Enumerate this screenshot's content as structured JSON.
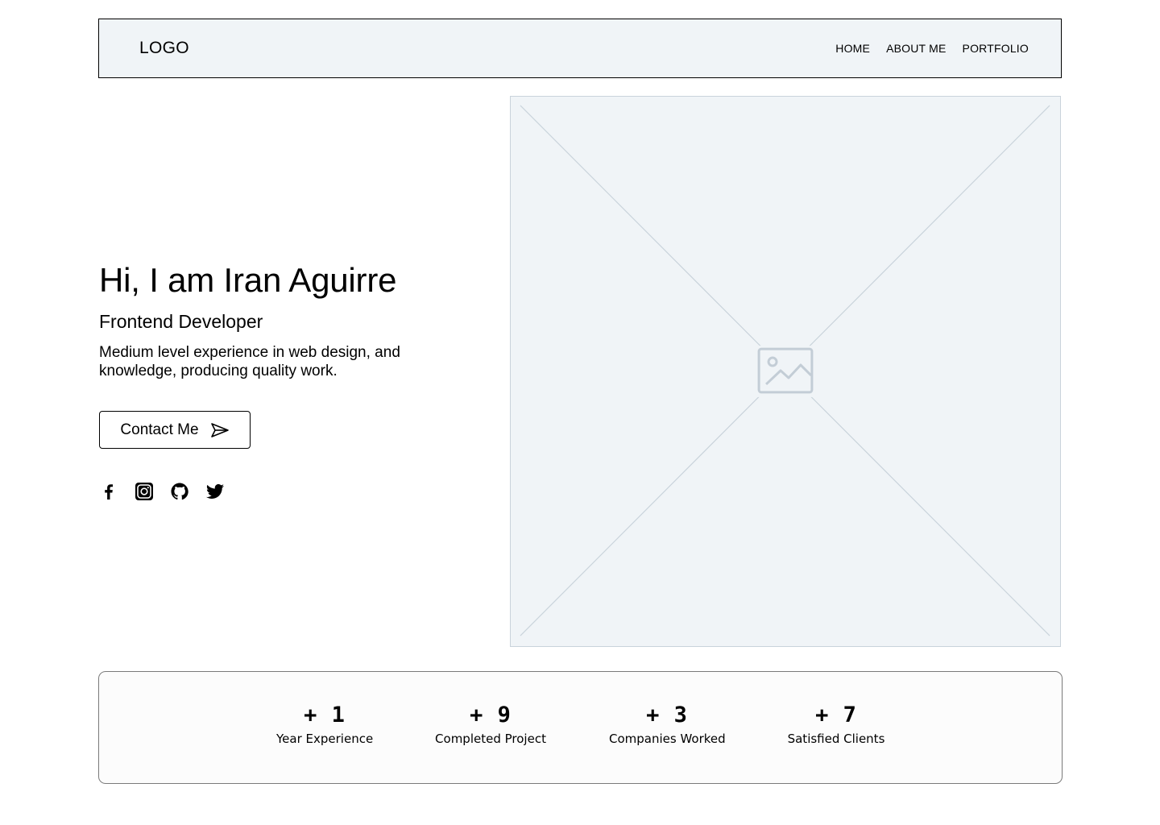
{
  "header": {
    "logo": "LOGO",
    "nav": [
      "HOME",
      "ABOUT ME",
      "PORTFOLIO"
    ]
  },
  "hero": {
    "title": "Hi, I am Iran Aguirre",
    "role": "Frontend Developer",
    "description": "Medium level experience in web design, and knowledge, producing quality work.",
    "contact_label": "Contact Me",
    "socials": [
      "facebook-icon",
      "instagram-icon",
      "github-icon",
      "twitter-icon"
    ]
  },
  "image_placeholder": {
    "icon": "image-icon"
  },
  "stats": [
    {
      "value": "+ 1",
      "label": "Year Experience"
    },
    {
      "value": "+ 9",
      "label": "Completed Project"
    },
    {
      "value": "+ 3",
      "label": "Companies Worked"
    },
    {
      "value": "+ 7",
      "label": "Satisfied Clients"
    }
  ],
  "colors": {
    "header_bg": "#f0f4f7",
    "placeholder_bg": "#f0f4f7",
    "placeholder_lines": "#c9d3db",
    "text": "#000000"
  }
}
